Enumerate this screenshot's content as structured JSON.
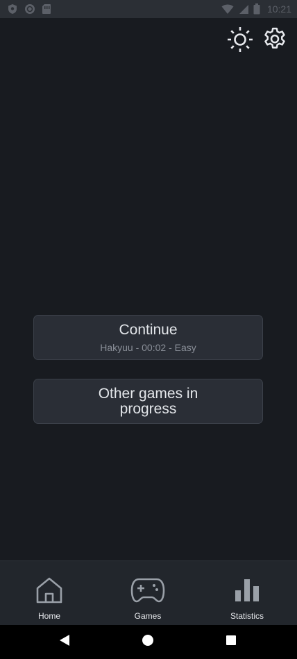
{
  "status_bar": {
    "time": "10:21",
    "left_icons": [
      "shield-icon",
      "circle-icon",
      "sim-card-icon"
    ],
    "right_icons": [
      "wifi-icon",
      "signal-icon",
      "battery-icon"
    ]
  },
  "top_actions": {
    "theme_icon": "sun-icon",
    "settings_icon": "gear-icon"
  },
  "continue": {
    "title": "Continue",
    "subtitle": "Hakyuu - 00:02 - Easy"
  },
  "other_games": {
    "title": "Other games in progress"
  },
  "bottom_nav": {
    "items": [
      {
        "label": "Home",
        "icon": "home-icon"
      },
      {
        "label": "Games",
        "icon": "gamepad-icon"
      },
      {
        "label": "Statistics",
        "icon": "bar-chart-icon"
      }
    ]
  },
  "system_nav": {
    "icons": [
      "back-icon",
      "home-circle-icon",
      "recents-icon"
    ]
  },
  "colors": {
    "background": "#181b20",
    "card": "#2a2e36",
    "card_border": "#3b4049",
    "nav_bar": "#22262c",
    "status_bar": "#2b2f35",
    "text": "#e3e6ea",
    "subtext": "#8a8f98"
  }
}
